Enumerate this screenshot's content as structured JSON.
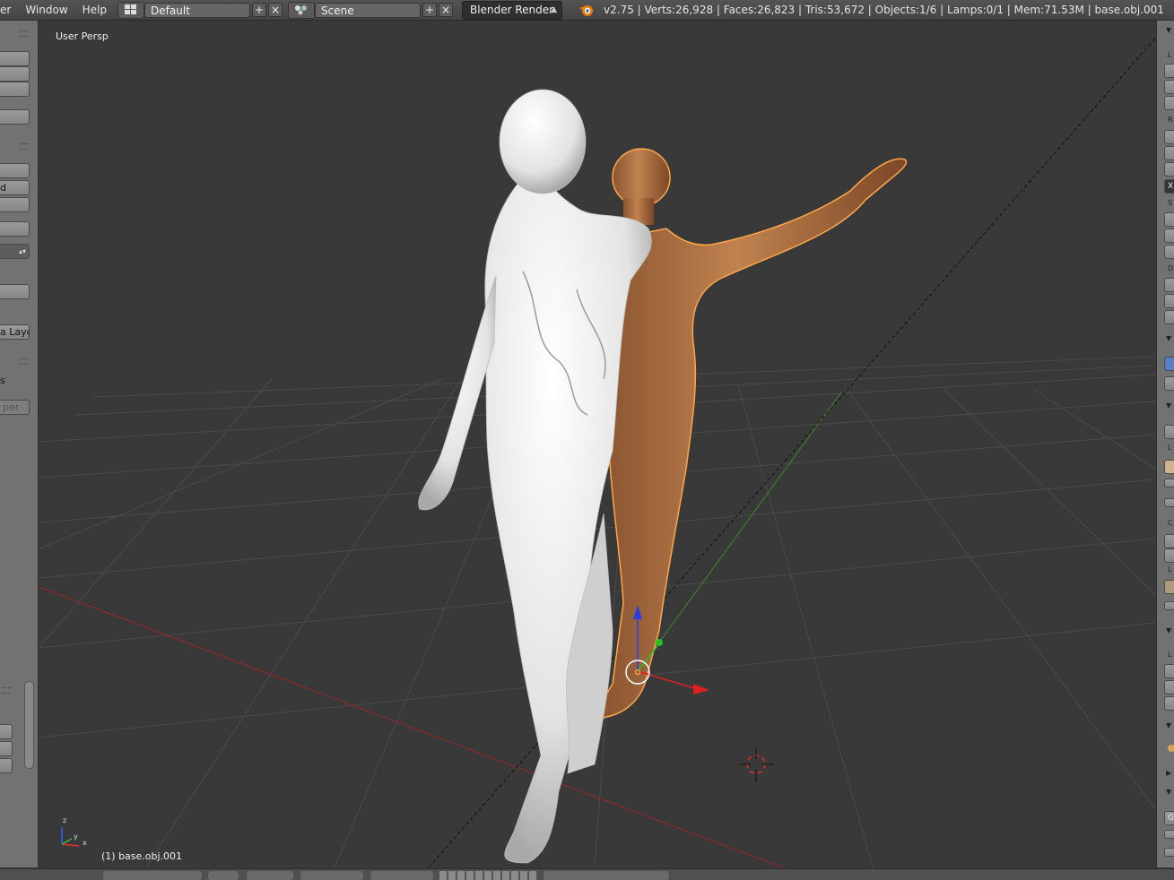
{
  "topbar": {
    "menus": [
      "er",
      "Window",
      "Help"
    ],
    "screen_layout": "Default",
    "scene": "Scene",
    "render_engine": "Blender Render",
    "stats": "v2.75 | Verts:26,928 | Faces:26,823 | Tris:53,672 | Objects:1/6 | Lamps:0/1 | Mem:71.53M | base.obj.001",
    "add_symbol": "+",
    "close_symbol": "×"
  },
  "left_shelf": {
    "partial_labels": [
      "d",
      "a Layo",
      "s",
      "per..."
    ]
  },
  "right_panel": {
    "partial_letters": [
      "L",
      "R",
      "X",
      "S",
      "D",
      "L",
      "C",
      "L",
      "L",
      "G"
    ]
  },
  "viewport": {
    "view_name": "User Persp",
    "active_object": "(1) base.obj.001",
    "axis_labels": {
      "x": "x",
      "y": "y",
      "z": "z"
    },
    "colors": {
      "background": "#393939",
      "grid": "#4a4a4a",
      "x_axis": "#8a2a2a",
      "y_axis": "#3a7a2a",
      "figure_white": "#e8e8e8",
      "figure_skin": "#b07040",
      "selection_outline": "#ffa64a"
    },
    "icons": [
      "3d-cursor-icon",
      "translate-gizmo-icon",
      "axis-widget-icon"
    ]
  }
}
